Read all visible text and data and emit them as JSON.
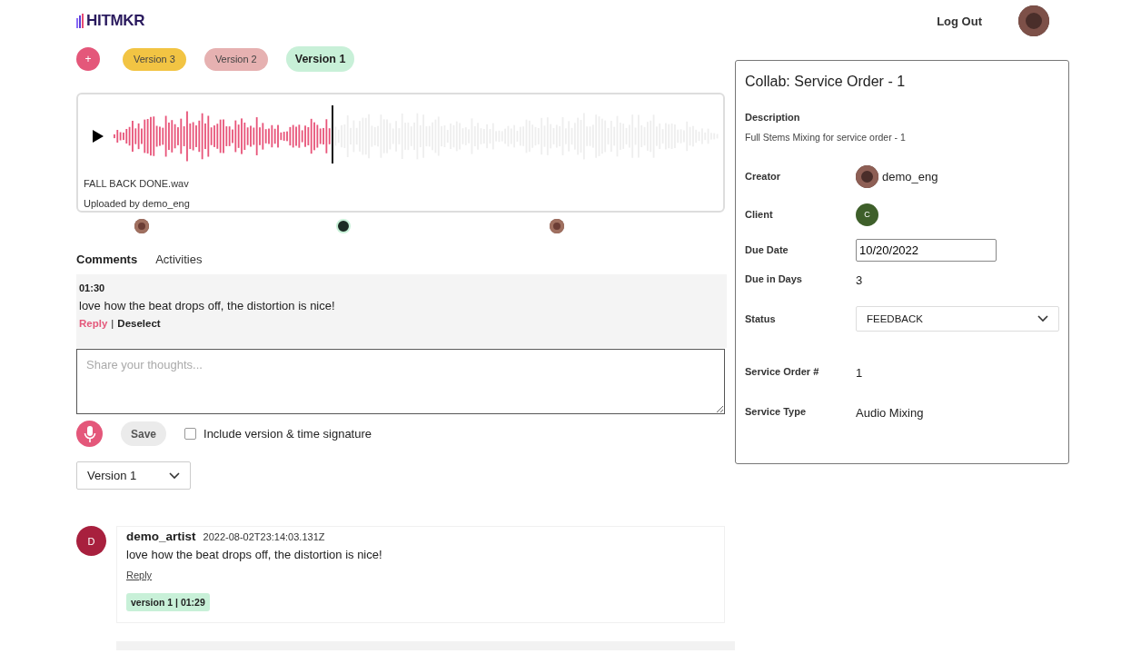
{
  "header": {
    "logo": "HITMKR",
    "logout": "Log Out"
  },
  "versions": {
    "add": "+",
    "items": [
      {
        "label": "Version 3",
        "color": "#f2c443",
        "selected": false
      },
      {
        "label": "Version 2",
        "color": "#e6b1b1",
        "selected": false
      },
      {
        "label": "Version 1",
        "color": "#c8f0d8",
        "selected": true
      }
    ]
  },
  "player": {
    "level": 0.36,
    "filename": "FALL BACK DONE.wav",
    "uploaded_by": "Uploaded by demo_eng",
    "markers": [
      {
        "kind": "avatar"
      },
      {
        "kind": "info"
      },
      {
        "kind": "avatar"
      }
    ]
  },
  "tabs": [
    {
      "label": "Comments",
      "selected": true
    },
    {
      "label": "Activities",
      "selected": false
    }
  ],
  "selected_comment": {
    "time": "01:30",
    "text": "love how the beat drops off, the distortion is nice!",
    "reply": "Reply",
    "separator": "|",
    "deselect": "Deselect"
  },
  "composer": {
    "placeholder": "Share your thoughts...",
    "save": "Save",
    "include_label": "Include version & time signature",
    "include_checked": false,
    "version_select": "Version 1"
  },
  "comments": [
    {
      "initial": "D",
      "author": "demo_artist",
      "timestamp": "2022-08-02T23:14:03.131Z",
      "text": "love how the beat drops off, the distortion is nice!",
      "reply": "Reply",
      "tag": "version 1 | 01:29"
    }
  ],
  "panel": {
    "title": "Collab: Service Order - 1",
    "description_label": "Description",
    "description": "Full Stems Mixing for service order - 1",
    "fields": [
      {
        "kind": "user",
        "label": "Creator",
        "value": "demo_eng"
      },
      {
        "kind": "initial",
        "label": "Client",
        "value": "C"
      },
      {
        "kind": "date",
        "label": "Due Date",
        "value": "10/20/2022"
      },
      {
        "kind": "text",
        "label": "Due in Days",
        "value": "3"
      },
      {
        "kind": "select",
        "label": "Status",
        "value": "FEEDBACK"
      },
      {
        "kind": "text",
        "label": "Service Order #",
        "value": "1"
      },
      {
        "kind": "text",
        "label": "Service Type",
        "value": "Audio Mixing"
      }
    ]
  }
}
